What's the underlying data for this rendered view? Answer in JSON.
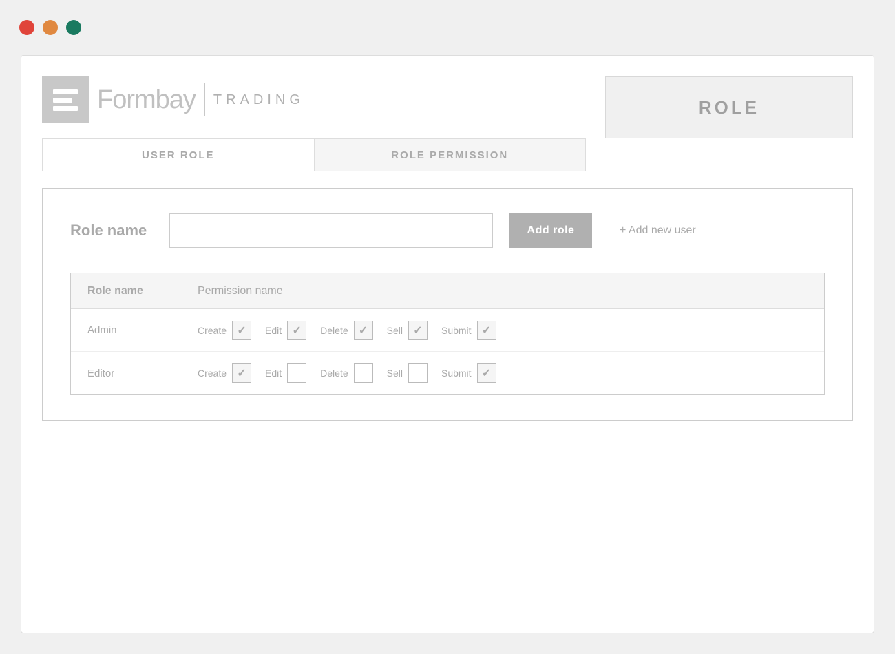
{
  "titlebar": {
    "traffic_lights": [
      {
        "color": "red",
        "label": "close"
      },
      {
        "color": "orange",
        "label": "minimize"
      },
      {
        "color": "green",
        "label": "maximize"
      }
    ]
  },
  "header": {
    "logo_name": "Formbay",
    "logo_trading": "TRADING",
    "role_button_label": "ROLE"
  },
  "tabs": [
    {
      "id": "user-role",
      "label": "USER ROLE",
      "active": false
    },
    {
      "id": "role-permission",
      "label": "ROLE PERMISSION",
      "active": true
    }
  ],
  "form": {
    "role_name_label": "Role name",
    "role_name_placeholder": "",
    "add_role_btn": "Add role",
    "add_new_user_link": "+ Add new user"
  },
  "table": {
    "col_role": "Role name",
    "col_permission": "Permission name",
    "rows": [
      {
        "role": "Admin",
        "permissions": [
          {
            "label": "Create",
            "checked": true
          },
          {
            "label": "Edit",
            "checked": true
          },
          {
            "label": "Delete",
            "checked": true
          },
          {
            "label": "Sell",
            "checked": true
          },
          {
            "label": "Submit",
            "checked": true
          }
        ]
      },
      {
        "role": "Editor",
        "permissions": [
          {
            "label": "Create",
            "checked": true
          },
          {
            "label": "Edit",
            "checked": false
          },
          {
            "label": "Delete",
            "checked": false
          },
          {
            "label": "Sell",
            "checked": false
          },
          {
            "label": "Submit",
            "checked": true
          }
        ]
      }
    ]
  }
}
